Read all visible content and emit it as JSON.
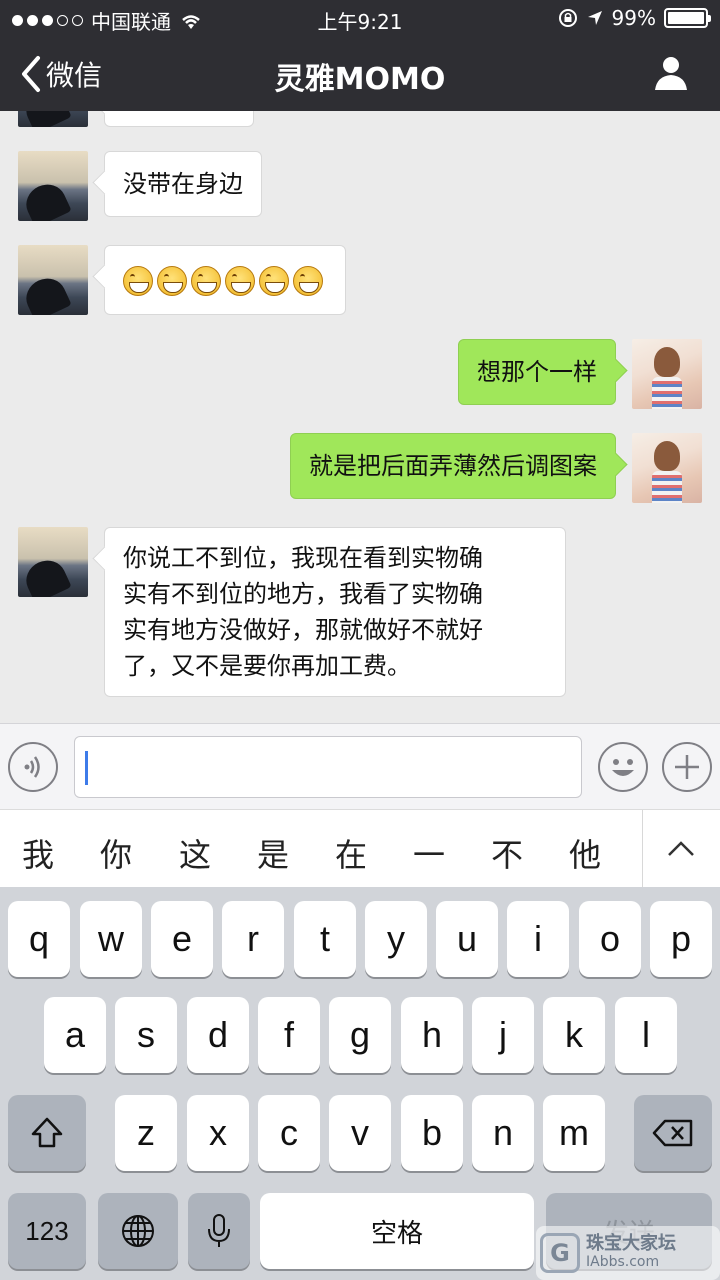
{
  "status_bar": {
    "carrier": "中国联通",
    "time": "上午9:21",
    "battery": "99%"
  },
  "nav": {
    "back_label": "微信",
    "title": "灵雅MOMO"
  },
  "messages": [
    {
      "side": "theirs",
      "text": "没带在身边"
    },
    {
      "side": "theirs",
      "emoji_count": 6,
      "emoji": "grin-emoji"
    },
    {
      "side": "mine",
      "text": "想那个一样"
    },
    {
      "side": "mine",
      "text": "就是把后面弄薄然后调图案"
    },
    {
      "side": "theirs",
      "lines": [
        "你说工不到位，我现在看到实物确",
        "实有不到位的地方，我看了实物确",
        "实有地方没做好，那就做好不就好",
        "了，又不是要你再加工费。"
      ]
    }
  ],
  "input": {
    "value": ""
  },
  "suggestions": [
    "我",
    "你",
    "这",
    "是",
    "在",
    "一",
    "不",
    "他"
  ],
  "keyboard": {
    "row1": [
      "q",
      "w",
      "e",
      "r",
      "t",
      "y",
      "u",
      "i",
      "o",
      "p"
    ],
    "row2": [
      "a",
      "s",
      "d",
      "f",
      "g",
      "h",
      "j",
      "k",
      "l"
    ],
    "row3": [
      "z",
      "x",
      "c",
      "v",
      "b",
      "n",
      "m"
    ],
    "numbers_key": "123",
    "space_key": "空格",
    "send_key": "发送"
  },
  "watermark": {
    "logo": "G",
    "name": "珠宝大家坛",
    "url": "IAbbs.com"
  },
  "colors": {
    "mine_bubble": "#a0e75a",
    "theirs_bubble": "#ffffff",
    "topbar": "#2e2e33"
  }
}
